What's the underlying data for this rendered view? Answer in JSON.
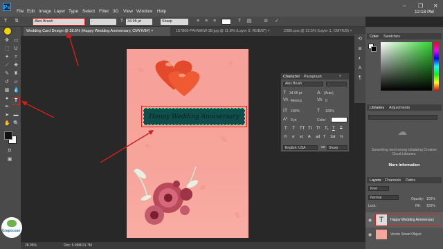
{
  "app": {
    "logo": "Ps",
    "clock": "12:18 PM"
  },
  "menu": [
    "File",
    "Edit",
    "Image",
    "Layer",
    "Type",
    "Select",
    "Filter",
    "3D",
    "View",
    "Window",
    "Help"
  ],
  "window_controls": [
    "–",
    "❐",
    "✕"
  ],
  "options_bar": {
    "font_family": "Alex Brush",
    "font_size": "34.95 pt",
    "antialias": "Sharp",
    "font_style": "-"
  },
  "doc_tabs": [
    {
      "label": "Wedding Card Design @ 28.5% (Happy Wedding Anniversary, CMYK/8#) ×",
      "active": true
    },
    {
      "label": "157808-PAHWKW-38.jpg @ 11.8% (Layer 0, RGB/8*) ×",
      "active": false
    },
    {
      "label": "2385.eps @ 12.5% (Layer 1, CMYK/8) ×",
      "active": false
    }
  ],
  "card": {
    "text": "Happy Wedding Anniversary"
  },
  "status": {
    "zoom": "28.95%",
    "doc": "Doc: 5.99M/31.7M"
  },
  "character_panel": {
    "tabs": [
      "Character",
      "Paragraph"
    ],
    "font_family": "Alex Brush",
    "font_style": "-",
    "font_size": "34.95 pt",
    "leading": "(Auto)",
    "kerning": "Metrics",
    "tracking": "0",
    "vscale": "100%",
    "hscale": "100%",
    "baseline": "0 pt",
    "color_label": "Color:",
    "style_buttons": [
      "T",
      "T",
      "TT",
      "Tt",
      "T¹",
      "T₁",
      "T",
      "T"
    ],
    "feature_buttons": [
      "fi",
      "ơ",
      "st",
      "A",
      "ad",
      "T",
      "1st",
      "½"
    ],
    "language": "English: USA",
    "antialias": "Sharp"
  },
  "color_panel": {
    "tabs": [
      "Color",
      "Swatches"
    ]
  },
  "libraries_panel": {
    "tabs": [
      "Libraries",
      "Adjustments"
    ],
    "error_text": "Something went wrong initializing Creative Cloud Libraries.",
    "more_info": "More Information"
  },
  "layers_panel": {
    "tabs": [
      "Layers",
      "Channels",
      "Paths"
    ],
    "kind": "Kind",
    "blend_mode": "Normal",
    "opacity_label": "Opacity:",
    "opacity": "100%",
    "lock_label": "Lock:",
    "fill_label": "Fill:",
    "fill": "100%",
    "layers": [
      {
        "name": "Happy Wedding Anniversary",
        "thumb": "T",
        "selected": true
      },
      {
        "name": "Vector Smart Object",
        "thumb": "",
        "selected": false
      }
    ]
  },
  "watermark": {
    "name": "Grapocean"
  },
  "colors": {
    "highlight": "#e0201d",
    "text_bg": "#0e4f4b",
    "accent": "#31a8ff"
  },
  "icons": [
    "move-icon",
    "marquee-icon",
    "lasso-icon",
    "magic-wand-icon",
    "crop-icon",
    "eyedropper-icon",
    "healing-brush-icon",
    "brush-icon",
    "clone-stamp-icon",
    "history-brush-icon",
    "eraser-icon",
    "gradient-icon",
    "blur-icon",
    "dodge-icon",
    "pen-icon",
    "type-icon",
    "path-selection-icon",
    "rectangle-icon",
    "hand-icon",
    "zoom-icon"
  ]
}
